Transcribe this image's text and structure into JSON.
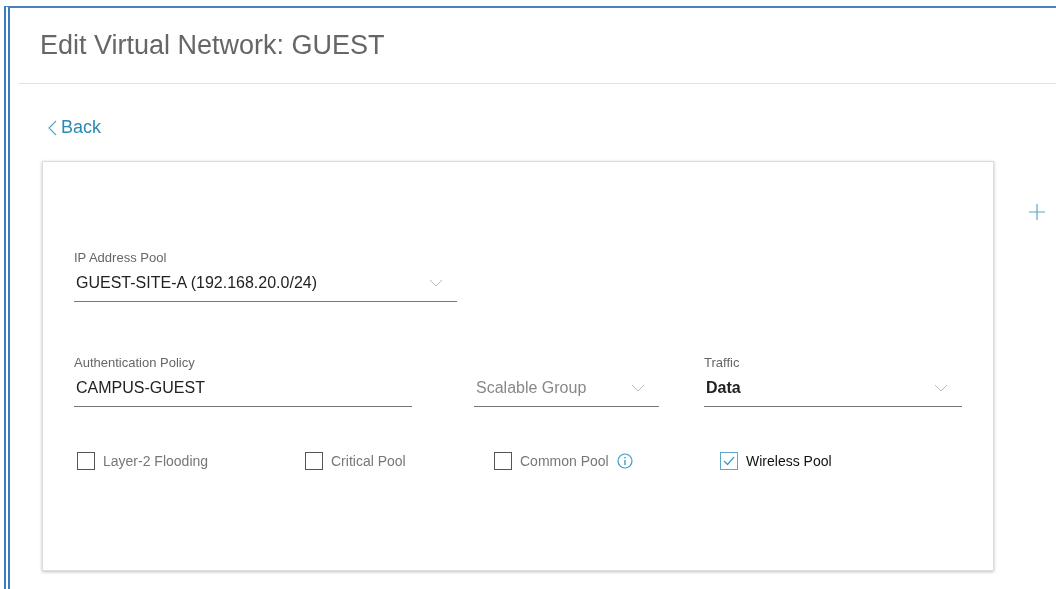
{
  "title": "Edit Virtual Network: GUEST",
  "back_link": {
    "label": "Back"
  },
  "ip_address_pool": {
    "label": "IP Address Pool",
    "value": "GUEST-SITE-A (192.168.20.0/24)"
  },
  "authentication_policy": {
    "label": "Authentication Policy",
    "value": "CAMPUS-GUEST"
  },
  "scalable_group": {
    "placeholder": "Scalable Group"
  },
  "traffic": {
    "label": "Traffic",
    "value": "Data"
  },
  "options": [
    {
      "label": "Layer-2 Flooding",
      "checked": false,
      "info": false
    },
    {
      "label": "Critical Pool",
      "checked": false,
      "info": false
    },
    {
      "label": "Common Pool",
      "checked": false,
      "info": true
    },
    {
      "label": "Wireless Pool",
      "checked": true,
      "info": false
    }
  ]
}
